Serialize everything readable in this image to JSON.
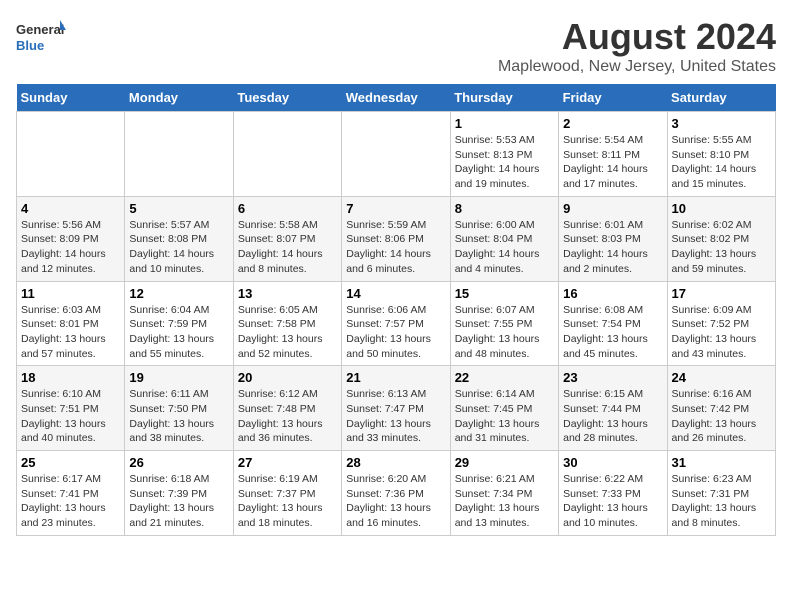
{
  "logo": {
    "general": "General",
    "blue": "Blue"
  },
  "title": "August 2024",
  "subtitle": "Maplewood, New Jersey, United States",
  "headers": [
    "Sunday",
    "Monday",
    "Tuesday",
    "Wednesday",
    "Thursday",
    "Friday",
    "Saturday"
  ],
  "weeks": [
    [
      {
        "day": "",
        "info": ""
      },
      {
        "day": "",
        "info": ""
      },
      {
        "day": "",
        "info": ""
      },
      {
        "day": "",
        "info": ""
      },
      {
        "day": "1",
        "info": "Sunrise: 5:53 AM\nSunset: 8:13 PM\nDaylight: 14 hours\nand 19 minutes."
      },
      {
        "day": "2",
        "info": "Sunrise: 5:54 AM\nSunset: 8:11 PM\nDaylight: 14 hours\nand 17 minutes."
      },
      {
        "day": "3",
        "info": "Sunrise: 5:55 AM\nSunset: 8:10 PM\nDaylight: 14 hours\nand 15 minutes."
      }
    ],
    [
      {
        "day": "4",
        "info": "Sunrise: 5:56 AM\nSunset: 8:09 PM\nDaylight: 14 hours\nand 12 minutes."
      },
      {
        "day": "5",
        "info": "Sunrise: 5:57 AM\nSunset: 8:08 PM\nDaylight: 14 hours\nand 10 minutes."
      },
      {
        "day": "6",
        "info": "Sunrise: 5:58 AM\nSunset: 8:07 PM\nDaylight: 14 hours\nand 8 minutes."
      },
      {
        "day": "7",
        "info": "Sunrise: 5:59 AM\nSunset: 8:06 PM\nDaylight: 14 hours\nand 6 minutes."
      },
      {
        "day": "8",
        "info": "Sunrise: 6:00 AM\nSunset: 8:04 PM\nDaylight: 14 hours\nand 4 minutes."
      },
      {
        "day": "9",
        "info": "Sunrise: 6:01 AM\nSunset: 8:03 PM\nDaylight: 14 hours\nand 2 minutes."
      },
      {
        "day": "10",
        "info": "Sunrise: 6:02 AM\nSunset: 8:02 PM\nDaylight: 13 hours\nand 59 minutes."
      }
    ],
    [
      {
        "day": "11",
        "info": "Sunrise: 6:03 AM\nSunset: 8:01 PM\nDaylight: 13 hours\nand 57 minutes."
      },
      {
        "day": "12",
        "info": "Sunrise: 6:04 AM\nSunset: 7:59 PM\nDaylight: 13 hours\nand 55 minutes."
      },
      {
        "day": "13",
        "info": "Sunrise: 6:05 AM\nSunset: 7:58 PM\nDaylight: 13 hours\nand 52 minutes."
      },
      {
        "day": "14",
        "info": "Sunrise: 6:06 AM\nSunset: 7:57 PM\nDaylight: 13 hours\nand 50 minutes."
      },
      {
        "day": "15",
        "info": "Sunrise: 6:07 AM\nSunset: 7:55 PM\nDaylight: 13 hours\nand 48 minutes."
      },
      {
        "day": "16",
        "info": "Sunrise: 6:08 AM\nSunset: 7:54 PM\nDaylight: 13 hours\nand 45 minutes."
      },
      {
        "day": "17",
        "info": "Sunrise: 6:09 AM\nSunset: 7:52 PM\nDaylight: 13 hours\nand 43 minutes."
      }
    ],
    [
      {
        "day": "18",
        "info": "Sunrise: 6:10 AM\nSunset: 7:51 PM\nDaylight: 13 hours\nand 40 minutes."
      },
      {
        "day": "19",
        "info": "Sunrise: 6:11 AM\nSunset: 7:50 PM\nDaylight: 13 hours\nand 38 minutes."
      },
      {
        "day": "20",
        "info": "Sunrise: 6:12 AM\nSunset: 7:48 PM\nDaylight: 13 hours\nand 36 minutes."
      },
      {
        "day": "21",
        "info": "Sunrise: 6:13 AM\nSunset: 7:47 PM\nDaylight: 13 hours\nand 33 minutes."
      },
      {
        "day": "22",
        "info": "Sunrise: 6:14 AM\nSunset: 7:45 PM\nDaylight: 13 hours\nand 31 minutes."
      },
      {
        "day": "23",
        "info": "Sunrise: 6:15 AM\nSunset: 7:44 PM\nDaylight: 13 hours\nand 28 minutes."
      },
      {
        "day": "24",
        "info": "Sunrise: 6:16 AM\nSunset: 7:42 PM\nDaylight: 13 hours\nand 26 minutes."
      }
    ],
    [
      {
        "day": "25",
        "info": "Sunrise: 6:17 AM\nSunset: 7:41 PM\nDaylight: 13 hours\nand 23 minutes."
      },
      {
        "day": "26",
        "info": "Sunrise: 6:18 AM\nSunset: 7:39 PM\nDaylight: 13 hours\nand 21 minutes."
      },
      {
        "day": "27",
        "info": "Sunrise: 6:19 AM\nSunset: 7:37 PM\nDaylight: 13 hours\nand 18 minutes."
      },
      {
        "day": "28",
        "info": "Sunrise: 6:20 AM\nSunset: 7:36 PM\nDaylight: 13 hours\nand 16 minutes."
      },
      {
        "day": "29",
        "info": "Sunrise: 6:21 AM\nSunset: 7:34 PM\nDaylight: 13 hours\nand 13 minutes."
      },
      {
        "day": "30",
        "info": "Sunrise: 6:22 AM\nSunset: 7:33 PM\nDaylight: 13 hours\nand 10 minutes."
      },
      {
        "day": "31",
        "info": "Sunrise: 6:23 AM\nSunset: 7:31 PM\nDaylight: 13 hours\nand 8 minutes."
      }
    ]
  ]
}
